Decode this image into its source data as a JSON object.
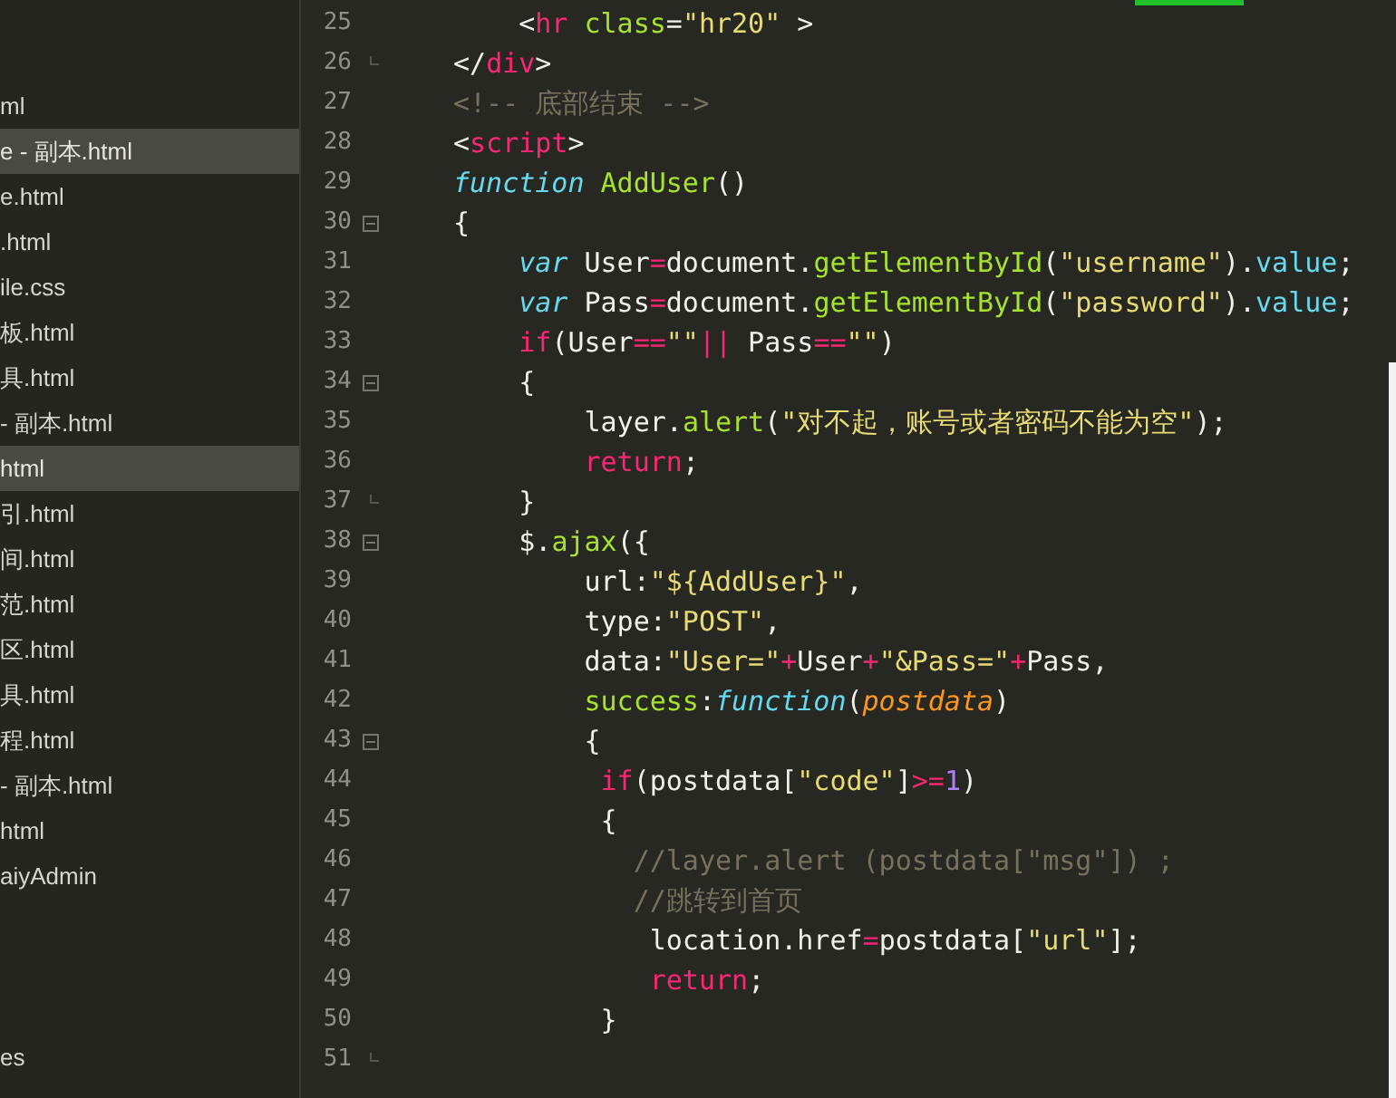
{
  "sidebar": {
    "items": [
      {
        "label": "ml",
        "selected": false
      },
      {
        "label": "e - 副本.html",
        "selected": true
      },
      {
        "label": "e.html",
        "selected": false
      },
      {
        "label": ".html",
        "selected": false
      },
      {
        "label": "ile.css",
        "selected": false
      },
      {
        "label": "板.html",
        "selected": false
      },
      {
        "label": "具.html",
        "selected": false
      },
      {
        "label": "- 副本.html",
        "selected": false
      },
      {
        "label": "html",
        "selected": true
      },
      {
        "label": "引.html",
        "selected": false
      },
      {
        "label": "间.html",
        "selected": false
      },
      {
        "label": "范.html",
        "selected": false
      },
      {
        "label": "区.html",
        "selected": false
      },
      {
        "label": "具.html",
        "selected": false
      },
      {
        "label": "程.html",
        "selected": false
      },
      {
        "label": "- 副本.html",
        "selected": false
      },
      {
        "label": "html",
        "selected": false
      },
      {
        "label": "aiyAdmin",
        "selected": false
      }
    ],
    "footer_item": {
      "label": "es"
    }
  },
  "editor": {
    "lines": [
      {
        "number": "25",
        "fold_start": false,
        "fold_end": false,
        "segments": [
          {
            "kind": "plain",
            "text": "    <"
          },
          {
            "kind": "tag",
            "text": "hr"
          },
          {
            "kind": "attr",
            "text": " class"
          },
          {
            "kind": "plain",
            "text": "="
          },
          {
            "kind": "str",
            "text": "\"hr20\""
          },
          {
            "kind": "plain",
            "text": " >"
          }
        ]
      },
      {
        "number": "26",
        "fold_start": false,
        "fold_end": true,
        "segments": [
          {
            "kind": "plain",
            "text": "</"
          },
          {
            "kind": "tag",
            "text": "div"
          },
          {
            "kind": "plain",
            "text": ">"
          }
        ]
      },
      {
        "number": "27",
        "fold_start": false,
        "fold_end": false,
        "segments": [
          {
            "kind": "comment",
            "text": "<!-- 底部结束 -->"
          }
        ]
      },
      {
        "number": "28",
        "fold_start": false,
        "fold_end": false,
        "segments": [
          {
            "kind": "plain",
            "text": "<"
          },
          {
            "kind": "tag",
            "text": "script"
          },
          {
            "kind": "plain",
            "text": ">"
          }
        ]
      },
      {
        "number": "29",
        "fold_start": false,
        "fold_end": false,
        "segments": [
          {
            "kind": "storage",
            "text": "function"
          },
          {
            "kind": "fn",
            "text": " AddUser"
          },
          {
            "kind": "plain",
            "text": "()"
          }
        ]
      },
      {
        "number": "30",
        "fold_start": true,
        "fold_end": false,
        "segments": [
          {
            "kind": "plain",
            "text": "{"
          }
        ]
      },
      {
        "number": "31",
        "fold_start": false,
        "fold_end": false,
        "segments": [
          {
            "kind": "storage",
            "text": "    var"
          },
          {
            "kind": "plain",
            "text": " User"
          },
          {
            "kind": "op",
            "text": "="
          },
          {
            "kind": "plain",
            "text": "document."
          },
          {
            "kind": "fn",
            "text": "getElementById"
          },
          {
            "kind": "plain",
            "text": "("
          },
          {
            "kind": "str",
            "text": "\"username\""
          },
          {
            "kind": "plain",
            "text": ")."
          },
          {
            "kind": "prop",
            "text": "value"
          },
          {
            "kind": "plain",
            "text": ";"
          }
        ]
      },
      {
        "number": "32",
        "fold_start": false,
        "fold_end": false,
        "segments": [
          {
            "kind": "storage",
            "text": "    var"
          },
          {
            "kind": "plain",
            "text": " Pass"
          },
          {
            "kind": "op",
            "text": "="
          },
          {
            "kind": "plain",
            "text": "document."
          },
          {
            "kind": "fn",
            "text": "getElementById"
          },
          {
            "kind": "plain",
            "text": "("
          },
          {
            "kind": "str",
            "text": "\"password\""
          },
          {
            "kind": "plain",
            "text": ")."
          },
          {
            "kind": "prop",
            "text": "value"
          },
          {
            "kind": "plain",
            "text": ";"
          }
        ]
      },
      {
        "number": "33",
        "fold_start": false,
        "fold_end": false,
        "segments": [
          {
            "kind": "kw",
            "text": "    if"
          },
          {
            "kind": "plain",
            "text": "(User"
          },
          {
            "kind": "op",
            "text": "=="
          },
          {
            "kind": "str",
            "text": "\"\""
          },
          {
            "kind": "op",
            "text": "||"
          },
          {
            "kind": "plain",
            "text": " Pass"
          },
          {
            "kind": "op",
            "text": "=="
          },
          {
            "kind": "str",
            "text": "\"\""
          },
          {
            "kind": "plain",
            "text": ")"
          }
        ]
      },
      {
        "number": "34",
        "fold_start": true,
        "fold_end": false,
        "segments": [
          {
            "kind": "plain",
            "text": "    {"
          }
        ]
      },
      {
        "number": "35",
        "fold_start": false,
        "fold_end": false,
        "segments": [
          {
            "kind": "plain",
            "text": "        layer."
          },
          {
            "kind": "fn",
            "text": "alert"
          },
          {
            "kind": "plain",
            "text": "("
          },
          {
            "kind": "str",
            "text": "\"对不起，账号或者密码不能为空\""
          },
          {
            "kind": "plain",
            "text": ");"
          }
        ]
      },
      {
        "number": "36",
        "fold_start": false,
        "fold_end": false,
        "segments": [
          {
            "kind": "kw",
            "text": "        return"
          },
          {
            "kind": "plain",
            "text": ";"
          }
        ]
      },
      {
        "number": "37",
        "fold_start": false,
        "fold_end": true,
        "segments": [
          {
            "kind": "plain",
            "text": "    }"
          }
        ]
      },
      {
        "number": "38",
        "fold_start": true,
        "fold_end": false,
        "segments": [
          {
            "kind": "plain",
            "text": "    $."
          },
          {
            "kind": "fn",
            "text": "ajax"
          },
          {
            "kind": "plain",
            "text": "({"
          }
        ]
      },
      {
        "number": "39",
        "fold_start": false,
        "fold_end": false,
        "segments": [
          {
            "kind": "plain",
            "text": "        url:"
          },
          {
            "kind": "str",
            "text": "\"${AddUser}\""
          },
          {
            "kind": "plain",
            "text": ","
          }
        ]
      },
      {
        "number": "40",
        "fold_start": false,
        "fold_end": false,
        "segments": [
          {
            "kind": "plain",
            "text": "        type:"
          },
          {
            "kind": "str",
            "text": "\"POST\""
          },
          {
            "kind": "plain",
            "text": ","
          }
        ]
      },
      {
        "number": "41",
        "fold_start": false,
        "fold_end": false,
        "segments": [
          {
            "kind": "plain",
            "text": "        data:"
          },
          {
            "kind": "str",
            "text": "\"User=\""
          },
          {
            "kind": "op",
            "text": "+"
          },
          {
            "kind": "plain",
            "text": "User"
          },
          {
            "kind": "op",
            "text": "+"
          },
          {
            "kind": "str",
            "text": "\"&Pass=\""
          },
          {
            "kind": "op",
            "text": "+"
          },
          {
            "kind": "plain",
            "text": "Pass,"
          }
        ]
      },
      {
        "number": "42",
        "fold_start": false,
        "fold_end": false,
        "segments": [
          {
            "kind": "fn",
            "text": "        success"
          },
          {
            "kind": "plain",
            "text": ":"
          },
          {
            "kind": "storage",
            "text": "function"
          },
          {
            "kind": "plain",
            "text": "("
          },
          {
            "kind": "param",
            "text": "postdata"
          },
          {
            "kind": "plain",
            "text": ")"
          }
        ]
      },
      {
        "number": "43",
        "fold_start": true,
        "fold_end": false,
        "segments": [
          {
            "kind": "plain",
            "text": "        {"
          }
        ]
      },
      {
        "number": "44",
        "fold_start": false,
        "fold_end": false,
        "segments": [
          {
            "kind": "kw",
            "text": "         if"
          },
          {
            "kind": "plain",
            "text": "(postdata["
          },
          {
            "kind": "str",
            "text": "\"code\""
          },
          {
            "kind": "plain",
            "text": "]"
          },
          {
            "kind": "op",
            "text": ">="
          },
          {
            "kind": "num",
            "text": "1"
          },
          {
            "kind": "plain",
            "text": ")"
          }
        ]
      },
      {
        "number": "45",
        "fold_start": false,
        "fold_end": false,
        "segments": [
          {
            "kind": "plain",
            "text": "         {"
          }
        ]
      },
      {
        "number": "46",
        "fold_start": false,
        "fold_end": false,
        "segments": [
          {
            "kind": "comment",
            "text": "           //layer.alert (postdata[\"msg\"]) ;"
          }
        ]
      },
      {
        "number": "47",
        "fold_start": false,
        "fold_end": false,
        "segments": [
          {
            "kind": "comment",
            "text": "           //跳转到首页"
          }
        ]
      },
      {
        "number": "48",
        "fold_start": false,
        "fold_end": false,
        "segments": [
          {
            "kind": "plain",
            "text": "            location.href"
          },
          {
            "kind": "op",
            "text": "="
          },
          {
            "kind": "plain",
            "text": "postdata["
          },
          {
            "kind": "str",
            "text": "\"url\""
          },
          {
            "kind": "plain",
            "text": "];"
          }
        ]
      },
      {
        "number": "49",
        "fold_start": false,
        "fold_end": false,
        "segments": [
          {
            "kind": "kw",
            "text": "            return"
          },
          {
            "kind": "plain",
            "text": ";"
          }
        ]
      },
      {
        "number": "50",
        "fold_start": false,
        "fold_end": false,
        "segments": [
          {
            "kind": "plain",
            "text": "         }"
          }
        ]
      },
      {
        "number": "51",
        "fold_start": false,
        "fold_end": true
      }
    ]
  }
}
